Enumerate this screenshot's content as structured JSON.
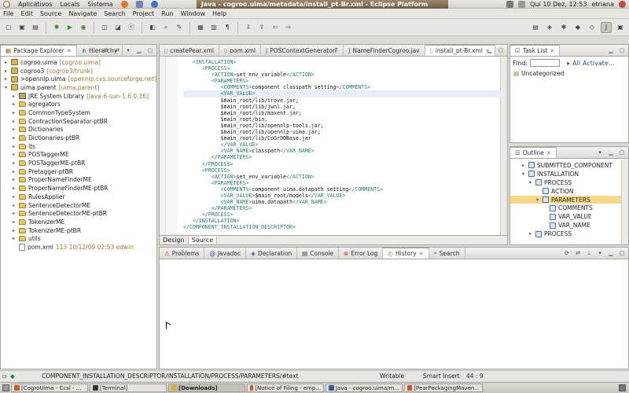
{
  "top_panel": {
    "menu": [
      "Aplicativos",
      "Locais",
      "Sistema"
    ],
    "window_title": "Java - cogroo.uima/metadata/install_pt-Br.xml - Eclipse Platform",
    "clock": "Qui 10 Dez, 12:53",
    "user": "etriana"
  },
  "menubar": [
    "File",
    "Edit",
    "Source",
    "Navigate",
    "Search",
    "Project",
    "Run",
    "Window",
    "Help"
  ],
  "package_explorer": {
    "tabs": [
      "Package Explorer",
      "Hierarchy"
    ],
    "rows": [
      {
        "indent": 0,
        "twisty": "▸",
        "icon": "project",
        "label": "cogroo.uima",
        "decoration": "[cogroo.uima]"
      },
      {
        "indent": 0,
        "twisty": "▸",
        "icon": "project",
        "label": "cogroo3",
        "decoration": "[cogroo3/trunk]"
      },
      {
        "indent": 0,
        "twisty": "▸",
        "icon": "project",
        "label": ">opennlp.uima",
        "decoration": "[opennlp.cvs.sourceforge.net]"
      },
      {
        "indent": 0,
        "twisty": "▾",
        "icon": "project",
        "label": "uima.parent",
        "decoration": "[uima.parent]"
      },
      {
        "indent": 1,
        "twisty": "▸",
        "icon": "library",
        "label": "JRE System Library",
        "decoration": "[java-6-sun-1.6.0.16]"
      },
      {
        "indent": 1,
        "twisty": "▸",
        "icon": "folder",
        "label": "agregators",
        "decoration": ""
      },
      {
        "indent": 1,
        "twisty": "▸",
        "icon": "folder",
        "label": "CommonTypeSystem",
        "decoration": ""
      },
      {
        "indent": 1,
        "twisty": "▸",
        "icon": "folder",
        "label": "ContractionSeparator-ptBR",
        "decoration": ""
      },
      {
        "indent": 1,
        "twisty": "▸",
        "icon": "folder",
        "label": "Dictionaries",
        "decoration": ""
      },
      {
        "indent": 1,
        "twisty": "▸",
        "icon": "folder",
        "label": "Dictionaries-ptBR",
        "decoration": ""
      },
      {
        "indent": 1,
        "twisty": "▸",
        "icon": "folder",
        "label": "its",
        "decoration": ""
      },
      {
        "indent": 1,
        "twisty": "▸",
        "icon": "folder",
        "label": "POSTaggerME",
        "decoration": ""
      },
      {
        "indent": 1,
        "twisty": "▸",
        "icon": "folder",
        "label": "POSTaggerME-ptBR",
        "decoration": ""
      },
      {
        "indent": 1,
        "twisty": "▸",
        "icon": "folder",
        "label": "Pretagger-ptBR",
        "decoration": ""
      },
      {
        "indent": 1,
        "twisty": "▸",
        "icon": "folder",
        "label": "ProperNameFinderME",
        "decoration": ""
      },
      {
        "indent": 1,
        "twisty": "▸",
        "icon": "folder",
        "label": "ProperNameFinderME-ptBR",
        "decoration": ""
      },
      {
        "indent": 1,
        "twisty": "▸",
        "icon": "folder",
        "label": "RulesApplier",
        "decoration": ""
      },
      {
        "indent": 1,
        "twisty": "▸",
        "icon": "folder",
        "label": "SentenceDetectorME",
        "decoration": ""
      },
      {
        "indent": 1,
        "twisty": "▸",
        "icon": "folder",
        "label": "SentenceDetectorME-ptBR",
        "decoration": ""
      },
      {
        "indent": 1,
        "twisty": "▸",
        "icon": "folder",
        "label": "TokenizerME",
        "decoration": ""
      },
      {
        "indent": 1,
        "twisty": "▸",
        "icon": "folder",
        "label": "TokenizerME-ptBR",
        "decoration": ""
      },
      {
        "indent": 1,
        "twisty": "▸",
        "icon": "folder",
        "label": "utils",
        "decoration": ""
      },
      {
        "indent": 1,
        "twisty": "",
        "icon": "xml",
        "label": "pom.xml",
        "decoration": "113  10/12/09 02:53  edwin"
      }
    ]
  },
  "editor": {
    "tabs": [
      "createPear.xml",
      "pom.xml",
      "POSContextGeneratorF",
      "NameFinderCogroo.jav",
      "install_pt-Br.xml"
    ],
    "active_tab": "install_pt-Br.xml",
    "lines": [
      {
        "indent": "   ",
        "segments": [
          {
            "t": "<INSTALLATION>",
            "c": "tag"
          }
        ]
      },
      {
        "indent": "      ",
        "segments": [
          {
            "t": "<PROCESS>",
            "c": "tag"
          }
        ]
      },
      {
        "indent": "         ",
        "segments": [
          {
            "t": "<ACTION>",
            "c": "tag"
          },
          {
            "t": "set_env_variable",
            "c": "txt"
          },
          {
            "t": "</ACTION>",
            "c": "tag"
          }
        ]
      },
      {
        "indent": "         ",
        "segments": [
          {
            "t": "<PARAMETERS>",
            "c": "tag"
          }
        ]
      },
      {
        "indent": "            ",
        "segments": [
          {
            "t": "<COMMENTS>",
            "c": "tag"
          },
          {
            "t": "component classpath setting",
            "c": "txt"
          },
          {
            "t": "</COMMENTS>",
            "c": "tag"
          }
        ]
      },
      {
        "indent": "            ",
        "segments": [
          {
            "t": "<VAR_VALUE>",
            "c": "tag"
          }
        ],
        "highlight": true
      },
      {
        "indent": "            ",
        "segments": [
          {
            "t": "$main_root/lib/trove.jar;",
            "c": "txt"
          }
        ]
      },
      {
        "indent": "            ",
        "segments": [
          {
            "t": "$main_root/lib/jwnl.jar;",
            "c": "txt"
          }
        ]
      },
      {
        "indent": "            ",
        "segments": [
          {
            "t": "$main_root/lib/maxent.jar;",
            "c": "txt"
          }
        ]
      },
      {
        "indent": "            ",
        "segments": [
          {
            "t": "$main_root/bin;",
            "c": "txt"
          }
        ]
      },
      {
        "indent": "            ",
        "segments": [
          {
            "t": "$main_root/lib/opennlp-tools.jar;",
            "c": "txt"
          }
        ]
      },
      {
        "indent": "            ",
        "segments": [
          {
            "t": "$main_root/lib/opennlp-uima.jar;",
            "c": "txt"
          }
        ]
      },
      {
        "indent": "            ",
        "segments": [
          {
            "t": "$main_root/lib/CoGrOOBase.jar",
            "c": "txt"
          }
        ]
      },
      {
        "indent": "            ",
        "segments": [
          {
            "t": "</VAR_VALUE>",
            "c": "tag"
          }
        ]
      },
      {
        "indent": "            ",
        "segments": [
          {
            "t": "<VAR_NAME>",
            "c": "tag"
          },
          {
            "t": "classpath",
            "c": "txt"
          },
          {
            "t": "</VAR_NAME>",
            "c": "tag"
          }
        ]
      },
      {
        "indent": "         ",
        "segments": [
          {
            "t": "</PARAMETERS>",
            "c": "tag"
          }
        ]
      },
      {
        "indent": "      ",
        "segments": [
          {
            "t": "</PROCESS>",
            "c": "tag"
          }
        ]
      },
      {
        "indent": "      ",
        "segments": [
          {
            "t": "<PROCESS>",
            "c": "tag"
          }
        ]
      },
      {
        "indent": "         ",
        "segments": [
          {
            "t": "<ACTION>",
            "c": "tag"
          },
          {
            "t": "set_env_variable",
            "c": "txt"
          },
          {
            "t": "</ACTION>",
            "c": "tag"
          }
        ]
      },
      {
        "indent": "         ",
        "segments": [
          {
            "t": "<PARAMETERS>",
            "c": "tag"
          }
        ]
      },
      {
        "indent": "            ",
        "segments": [
          {
            "t": "<COMMENTS>",
            "c": "tag"
          },
          {
            "t": "component uima.datapath setting",
            "c": "txt"
          },
          {
            "t": "</COMMENTS>",
            "c": "tag"
          }
        ]
      },
      {
        "indent": "            ",
        "segments": [
          {
            "t": "<VAR_VALUE>",
            "c": "tag"
          },
          {
            "t": "$main_root/models",
            "c": "txt"
          },
          {
            "t": "</VAR_VALUE>",
            "c": "tag"
          }
        ]
      },
      {
        "indent": "            ",
        "segments": [
          {
            "t": "<VAR_NAME>",
            "c": "tag"
          },
          {
            "t": "uima.datapath",
            "c": "txt"
          },
          {
            "t": "</VAR_NAME>",
            "c": "tag"
          }
        ]
      },
      {
        "indent": "         ",
        "segments": [
          {
            "t": "</PARAMETERS>",
            "c": "tag"
          }
        ]
      },
      {
        "indent": "      ",
        "segments": [
          {
            "t": "</PROCESS>",
            "c": "tag"
          }
        ]
      },
      {
        "indent": "   ",
        "segments": [
          {
            "t": "</INSTALLATION>",
            "c": "tag"
          }
        ]
      },
      {
        "indent": "",
        "segments": [
          {
            "t": "</COMPONENT_INSTALLATION_DESCRIPTOR>",
            "c": "tag"
          }
        ]
      }
    ],
    "bottom_tabs": [
      "Design",
      "Source"
    ]
  },
  "task_list": {
    "tab": "Task List",
    "find_label": "Find:",
    "all_label": "All",
    "activate_label": "Activate...",
    "category": "Uncategorized"
  },
  "outline": {
    "tab": "Outline",
    "rows": [
      {
        "indent": 1,
        "twisty": "▸",
        "label": "SUBMITTED_COMPONENT",
        "selected": false
      },
      {
        "indent": 1,
        "twisty": "▾",
        "label": "INSTALLATION",
        "selected": false
      },
      {
        "indent": 2,
        "twisty": "▾",
        "label": "PROCESS",
        "selected": false
      },
      {
        "indent": 3,
        "twisty": "",
        "label": "ACTION",
        "selected": false
      },
      {
        "indent": 3,
        "twisty": "▾",
        "label": "PARAMETERS",
        "selected": true
      },
      {
        "indent": 4,
        "twisty": "",
        "label": "COMMENTS",
        "selected": false
      },
      {
        "indent": 4,
        "twisty": "",
        "label": "VAR_VALUE",
        "selected": false
      },
      {
        "indent": 4,
        "twisty": "",
        "label": "VAR_NAME",
        "selected": false
      },
      {
        "indent": 2,
        "twisty": "▸",
        "label": "PROCESS",
        "selected": false
      }
    ]
  },
  "bottom_views": {
    "tabs": [
      "Problems",
      "Javadoc",
      "Declaration",
      "Console",
      "Error Log",
      "History",
      "Search"
    ],
    "active_tab": "History"
  },
  "statusbar": {
    "path": "COMPONENT_INSTALLATION_DESCRIPTOR/INSTALLATION/PROCESS/PARAMETERS/#text",
    "writable": "Writable",
    "insert_mode": "Smart Insert",
    "position": "44 : 9"
  },
  "taskbar": {
    "items": [
      {
        "label": "[CogroUima - Ccsl - ...",
        "color": "#c85a2a",
        "active": false
      },
      {
        "label": "[Terminal]",
        "color": "#333333",
        "active": false
      },
      {
        "label": "[Downloads]",
        "color": "#d9a93a",
        "active": true
      },
      {
        "label": "[Notice of Filing - emp...",
        "color": "#c85a2a",
        "active": false
      },
      {
        "label": "Java - cogroo.uima/m...",
        "color": "#3d5a96",
        "active": false
      },
      {
        "label": "[PearPackagingMaven...",
        "color": "#c85a2a",
        "active": false
      }
    ]
  },
  "colors": {
    "xml_tag": "#2f7a7a",
    "selection": "#f5d98c",
    "titlebar": "#6f5e44"
  }
}
